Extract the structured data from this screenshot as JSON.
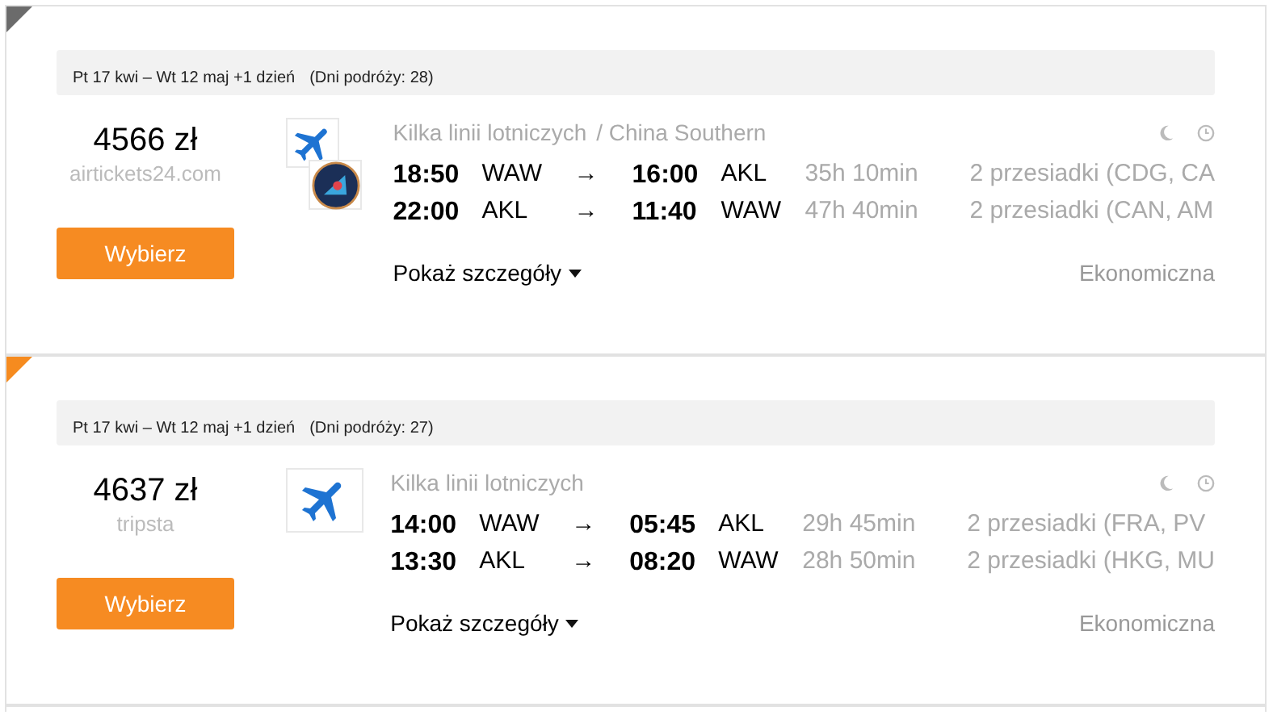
{
  "results": [
    {
      "color": "#6b6b6b",
      "dates": "Pt 17 kwi – Wt 12 maj +1 dzień",
      "trip_days": "(Dni podróży: 28)",
      "price": "4566 zł",
      "seller": "airtickets24.com",
      "button": "Wybierz",
      "logos": [
        {
          "kind": "plane"
        },
        {
          "kind": "roundel"
        }
      ],
      "airline": "Kilka linii lotniczych",
      "airline_extra": "/ China Southern",
      "legs": [
        {
          "depart": "18:50",
          "from": "WAW",
          "arrow": "→",
          "arrive": "16:00",
          "to": "AKL",
          "duration": "35h 10min",
          "stops": "2 przesiadki (CDG, CA"
        },
        {
          "depart": "22:00",
          "from": "AKL",
          "arrow": "→",
          "arrive": "11:40",
          "to": "WAW",
          "duration": "47h 40min",
          "stops": "2 przesiadki (CAN, AM"
        }
      ],
      "details": "Pokaż szczegóły",
      "cabin": "Ekonomiczna"
    },
    {
      "color": "#f68b1f",
      "dates": "Pt 17 kwi – Wt 12 maj +1 dzień",
      "trip_days": "(Dni podróży: 27)",
      "price": "4637 zł",
      "seller": "tripsta",
      "button": "Wybierz",
      "logos": [
        {
          "kind": "plane"
        }
      ],
      "airline": "Kilka linii lotniczych",
      "legs": [
        {
          "depart": "14:00",
          "from": "WAW",
          "arrow": "→",
          "arrive": "05:45",
          "to": "AKL",
          "duration": "29h 45min",
          "stops": "2 przesiadki (FRA, PV"
        },
        {
          "depart": "13:30",
          "from": "AKL",
          "arrow": "→",
          "arrive": "08:20",
          "to": "WAW",
          "duration": "28h 50min",
          "stops": "2 przesiadki (HKG, MU"
        }
      ],
      "details": "Pokaż szczegóły",
      "cabin": "Ekonomiczna"
    }
  ]
}
